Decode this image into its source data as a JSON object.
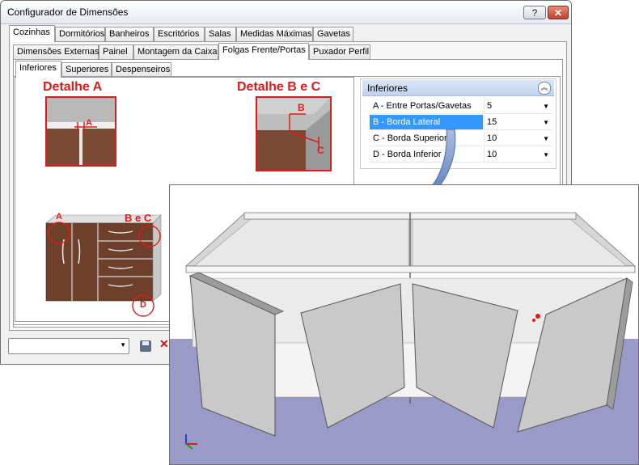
{
  "window": {
    "title": "Configurador de Dimensões",
    "help_label": "?",
    "close_label": "✕"
  },
  "tabs_level1": [
    "Cozinhas",
    "Dormitórios",
    "Banheiros",
    "Escritórios",
    "Salas",
    "Medidas Máximas",
    "Gavetas"
  ],
  "tabs_level2": [
    "Dimensões Externas",
    "Painel",
    "Montagem da Caixa",
    "Folgas Frente/Portas",
    "Puxador Perfil"
  ],
  "tabs_level3": [
    "Inferiores",
    "Superiores",
    "Despenseiros"
  ],
  "detail": {
    "a_title": "Detalhe A",
    "bc_title": "Detalhe B e C",
    "mark_a": "A",
    "mark_b": "B",
    "mark_c": "C",
    "callout_a": "A",
    "callout_bc": "B e C",
    "callout_d": "D"
  },
  "grid": {
    "header": "Inferiores",
    "rows": [
      {
        "label": "A - Entre Portas/Gavetas",
        "value": "5"
      },
      {
        "label": "B - Borda Lateral",
        "value": "15",
        "selected": true
      },
      {
        "label": "C - Borda Superior",
        "value": "10"
      },
      {
        "label": "D - Borda Inferior",
        "value": "10"
      }
    ]
  },
  "colors": {
    "accent_red": "#e01a1a",
    "selection": "#3399ff",
    "floor": "#9a9ac8",
    "cabinet": "#c9c9c9"
  }
}
